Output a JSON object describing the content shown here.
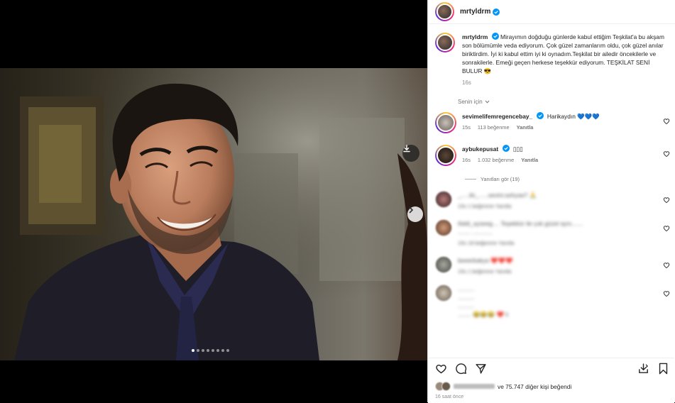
{
  "post": {
    "username": "mrtyldrm",
    "caption": "Mirayımın doğduğu günlerde kabul ettiğim Teşkilat'a bu akşam son bölümümle veda ediyorum. Çok güzel zamanlarım oldu, çok güzel anılar biriktirdim. İyi ki kabul ettim iyi ki oynadım.Teşkilat bir ailedir öncekilerle ve sonrakilerle. Emeği geçen herkese teşekkür ediyorum. TEŞKİLAT SENİ BULUR 😎",
    "caption_age": "16s",
    "for_you_label": "Senin için",
    "likes_suffix": "ve 75.747 diğer kişi beğendi",
    "post_time": "16 saat önce"
  },
  "comments": [
    {
      "username": "sevimelifemregencebay_",
      "text": "Harikaydın 💙💙💙",
      "age": "15s",
      "likes": "113 beğenme",
      "reply": "Yanıtla"
    },
    {
      "username": "aybukepusat",
      "text": "▯▯▯",
      "age": "16s",
      "likes": "1.032 beğenme",
      "reply": "Yanıtla"
    }
  ],
  "view_replies": "Yanıtları gör (19)",
  "blurred_comments": [
    {
      "line1": "_.....iki_......sevini.ashyaa? 🙏",
      "meta": "15s 1 beğenme Yanıtla"
    },
    {
      "line1": "ifaldi_ayseeg.... Teşekkür ile çok güzel aynı.......",
      "line2": "........ ............",
      "meta": "15s 18 beğenme Yanıtla"
    },
    {
      "line1": "beeerbakya ❤️❤️❤️",
      "meta": "15s 1 beğenme Yanıtla"
    },
    {
      "line1": "..........",
      "line2": "..........",
      "line3": "..........",
      "line4": "........ 😂😂😂 ❤️ ii"
    }
  ],
  "colors": {
    "accent": "#0095f6",
    "text": "#262626",
    "muted": "#8e8e8e"
  }
}
